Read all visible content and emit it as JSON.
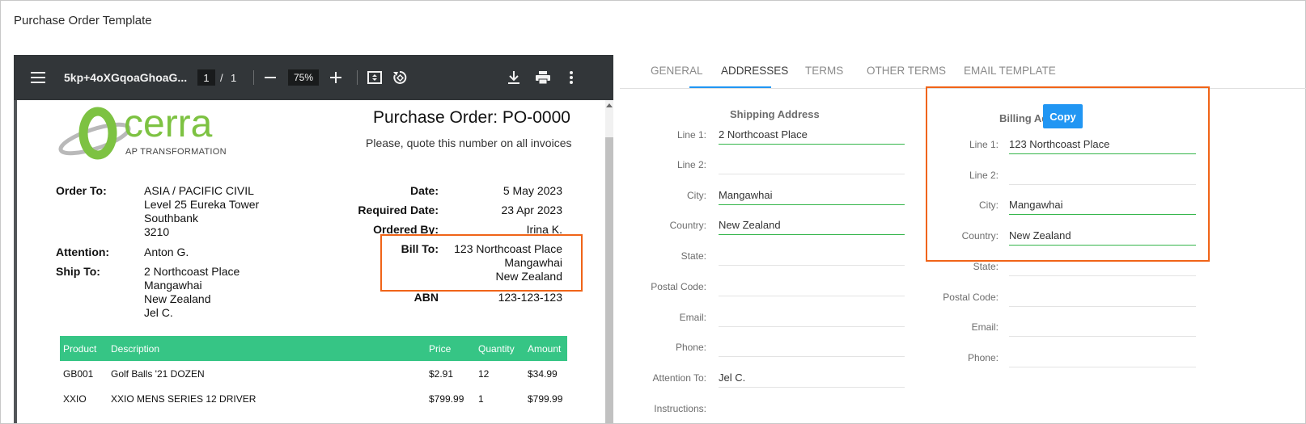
{
  "page": {
    "title": "Purchase Order Template"
  },
  "pdf_toolbar": {
    "filename": "5kp+4oXGqoaGhoaG...",
    "page_current": "1",
    "page_sep": "/",
    "page_total": "1",
    "zoom": "75%"
  },
  "document": {
    "logo_text": "cerra",
    "logo_tagline": "AP TRANSFORMATION",
    "title": "Purchase Order: PO-0000",
    "note": "Please, quote this number on all invoices",
    "order_to_label": "Order To:",
    "order_to_lines": [
      "ASIA / PACIFIC CIVIL",
      "Level 25 Eureka Tower",
      "Southbank",
      "3210"
    ],
    "attention_label": "Attention:",
    "attention_value": "Anton G.",
    "ship_to_label": "Ship To:",
    "ship_to_lines": [
      "2 Northcoast Place",
      "Mangawhai",
      "New Zealand",
      "Jel C."
    ],
    "date_label": "Date:",
    "date_value": "5 May 2023",
    "required_date_label": "Required Date:",
    "required_date_value": "23 Apr 2023",
    "ordered_by_label": "Ordered By:",
    "ordered_by_value": "Irina K.",
    "bill_to_label": "Bill To:",
    "bill_to_lines": [
      "123 Northcoast Place",
      "Mangawhai",
      "New Zealand"
    ],
    "abn_label": "ABN",
    "abn_value": "123-123-123",
    "table": {
      "headers": [
        "Product",
        "Description",
        "Price",
        "Quantity",
        "Amount"
      ],
      "rows": [
        [
          "GB001",
          "Golf Balls '21 DOZEN",
          "$2.91",
          "12",
          "$34.99"
        ],
        [
          "XXIO",
          "XXIO MENS SERIES 12 DRIVER",
          "$799.99",
          "1",
          "$799.99"
        ]
      ]
    }
  },
  "tabs": [
    "GENERAL",
    "ADDRESSES",
    "TERMS",
    "OTHER TERMS",
    "EMAIL TEMPLATE"
  ],
  "shipping": {
    "title": "Shipping Address",
    "fields": [
      {
        "label": "Line 1:",
        "value": "2 Northcoast Place"
      },
      {
        "label": "Line 2:",
        "value": ""
      },
      {
        "label": "City:",
        "value": "Mangawhai"
      },
      {
        "label": "Country:",
        "value": "New Zealand"
      },
      {
        "label": "State:",
        "value": ""
      },
      {
        "label": "Postal Code:",
        "value": ""
      },
      {
        "label": "Email:",
        "value": ""
      },
      {
        "label": "Phone:",
        "value": ""
      },
      {
        "label": "Attention To:",
        "value": "Jel C."
      },
      {
        "label": "Instructions:",
        "value": ""
      }
    ]
  },
  "billing": {
    "title": "Billing Address",
    "copy_label": "Copy",
    "fields": [
      {
        "label": "Line 1:",
        "value": "123 Northcoast Place"
      },
      {
        "label": "Line 2:",
        "value": ""
      },
      {
        "label": "City:",
        "value": "Mangawhai"
      },
      {
        "label": "Country:",
        "value": "New Zealand"
      },
      {
        "label": "State:",
        "value": ""
      },
      {
        "label": "Postal Code:",
        "value": ""
      },
      {
        "label": "Email:",
        "value": ""
      },
      {
        "label": "Phone:",
        "value": ""
      }
    ]
  },
  "colors": {
    "accent": "#2196f3",
    "valid_underline": "#34b54a",
    "highlight": "#f06418",
    "table_header": "#36c585"
  }
}
